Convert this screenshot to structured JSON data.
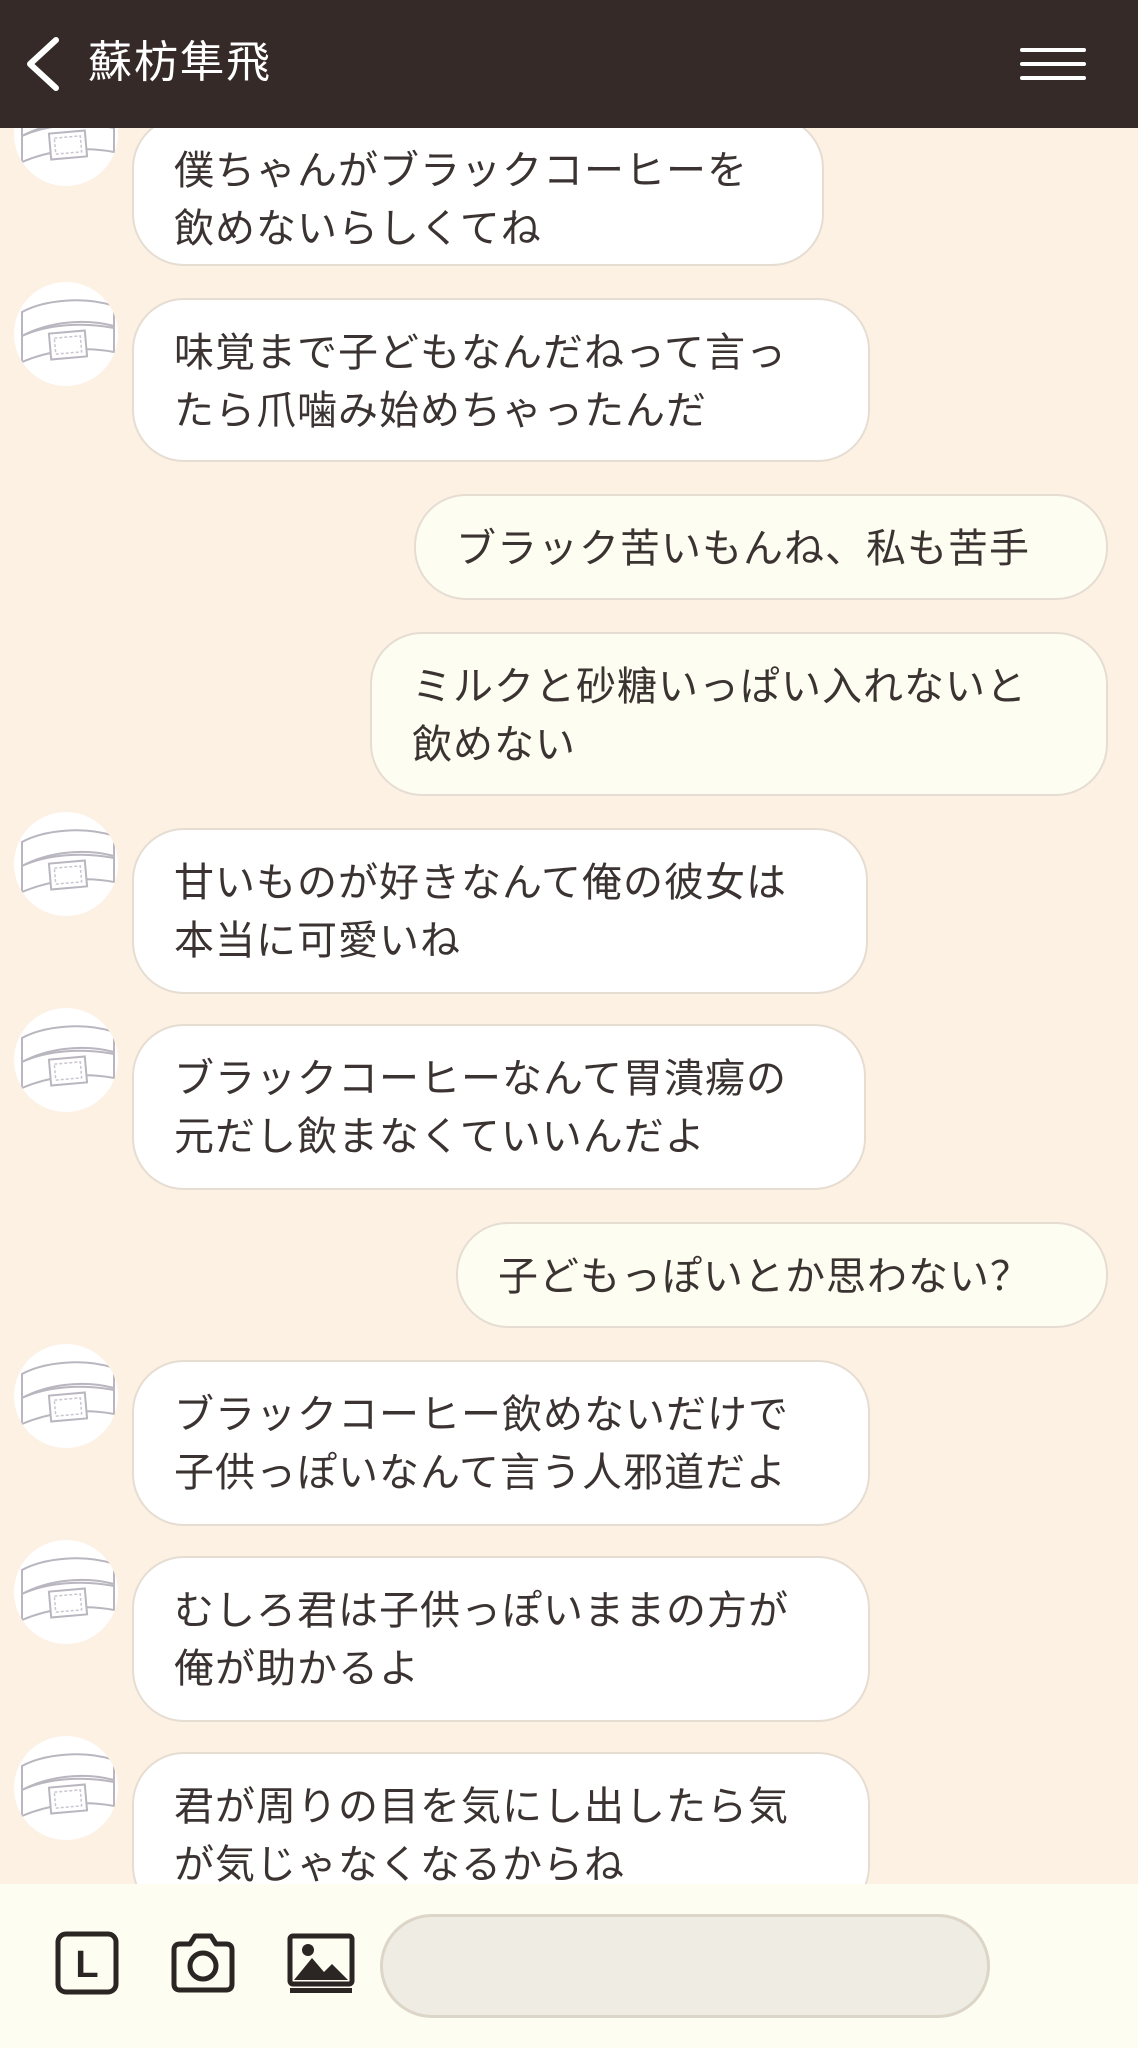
{
  "header": {
    "title": "蘇枋隼飛"
  },
  "messages": [
    {
      "side": "recv",
      "text": "僕ちゃんがブラックコーヒーを\n飲めないらしくてね"
    },
    {
      "side": "recv",
      "text": "味覚まで子どもなんだねって言っ\nたら爪噛み始めちゃったんだ"
    },
    {
      "side": "sent",
      "text": "ブラック苦いもんね、私も苦手"
    },
    {
      "side": "sent",
      "text": "ミルクと砂糖いっぱい入れないと\n飲めない"
    },
    {
      "side": "recv",
      "text": "甘いものが好きなんて俺の彼女は\n本当に可愛いね"
    },
    {
      "side": "recv",
      "text": "ブラックコーヒーなんて胃潰瘍の\n元だし飲まなくていいんだよ"
    },
    {
      "side": "sent",
      "text": "子どもっぽいとか思わない？"
    },
    {
      "side": "recv",
      "text": "ブラックコーヒー飲めないだけで\n子供っぽいなんて言う人邪道だよ"
    },
    {
      "side": "recv",
      "text": "むしろ君は子供っぽいままの方が\n俺が助かるよ"
    },
    {
      "side": "recv",
      "text": "君が周りの目を気にし出したら気\nが気じゃなくなるからね"
    }
  ],
  "toolbar": {
    "keep_icon_letter": "L",
    "input_value": "",
    "input_placeholder": ""
  },
  "icons": {
    "back": "chevron-left-icon",
    "menu": "hamburger-menu-icon",
    "keep": "l-square-icon",
    "camera": "camera-icon",
    "gallery": "image-icon"
  },
  "colors": {
    "header_bg": "#352a28",
    "chat_bg": "#fdf1e4",
    "received_bubble": "#ffffff",
    "sent_bubble": "#fefdf1",
    "bottom_bar_bg": "#fefdf1"
  }
}
